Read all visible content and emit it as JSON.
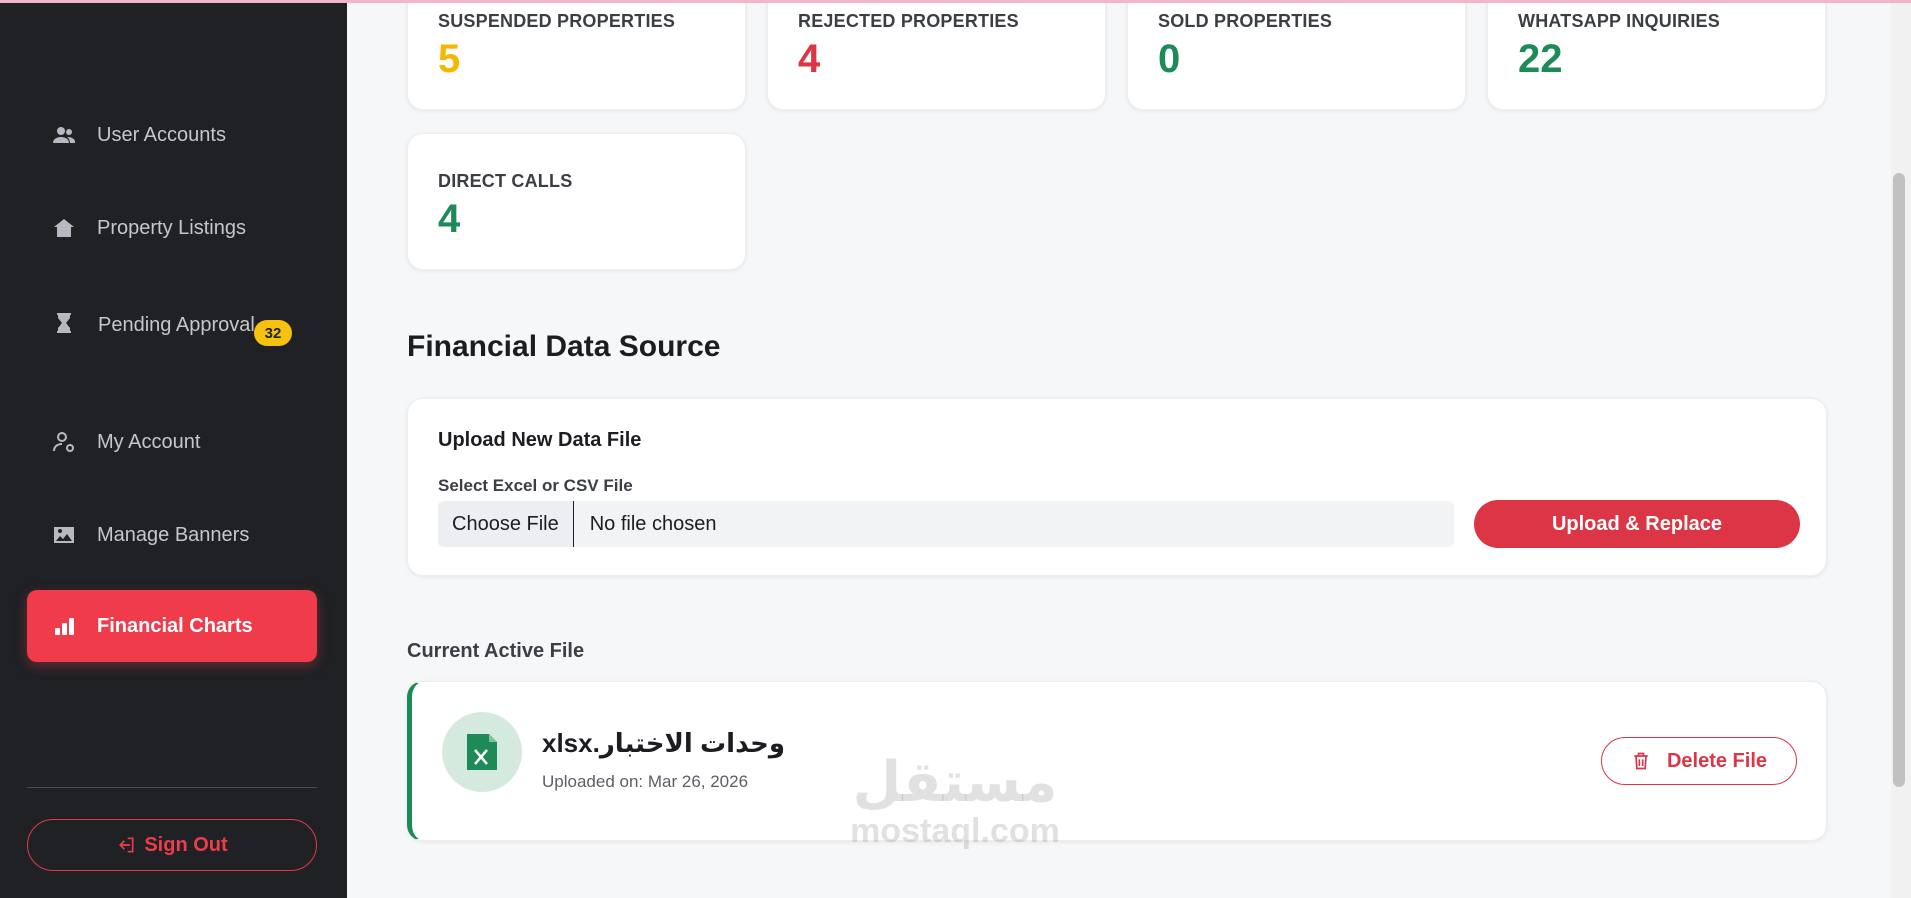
{
  "sidebar": {
    "items": [
      {
        "label": "User Accounts",
        "icon": "users-icon"
      },
      {
        "label": "Property Listings",
        "icon": "house-icon"
      },
      {
        "label": "Pending Approval",
        "icon": "hourglass-icon",
        "badge": "32"
      },
      {
        "label": "My Account",
        "icon": "user-gear-icon"
      },
      {
        "label": "Manage Banners",
        "icon": "image-icon"
      },
      {
        "label": "Financial Charts",
        "icon": "bar-chart-icon",
        "active": true
      }
    ],
    "signout_label": "Sign Out"
  },
  "stats": [
    {
      "label": "SUSPENDED PROPERTIES",
      "value": "5",
      "color": "#f5b800"
    },
    {
      "label": "REJECTED PROPERTIES",
      "value": "4",
      "color": "#dc3545"
    },
    {
      "label": "SOLD PROPERTIES",
      "value": "0",
      "color": "#1e8a57"
    },
    {
      "label": "WHATSAPP INQUIRIES",
      "value": "22",
      "color": "#1e8a57"
    },
    {
      "label": "DIRECT CALLS",
      "value": "4",
      "color": "#1e8a57"
    }
  ],
  "financial": {
    "section_title": "Financial Data Source",
    "upload_title": "Upload New Data File",
    "field_label": "Select Excel or CSV File",
    "choose_label": "Choose File",
    "file_status": "No file chosen",
    "upload_button": "Upload & Replace",
    "current_label": "Current Active File",
    "file_name": "وحدات الاختبار.xlsx",
    "uploaded_on": "Uploaded on: Mar 26, 2026",
    "delete_button": "Delete File"
  },
  "watermark": {
    "arabic": "مستقل",
    "latin": "mostaql.com"
  },
  "colors": {
    "accent": "#ef3b4a",
    "sidebar_bg": "#1f2125",
    "success": "#1e8a57",
    "warning": "#f5b800"
  }
}
